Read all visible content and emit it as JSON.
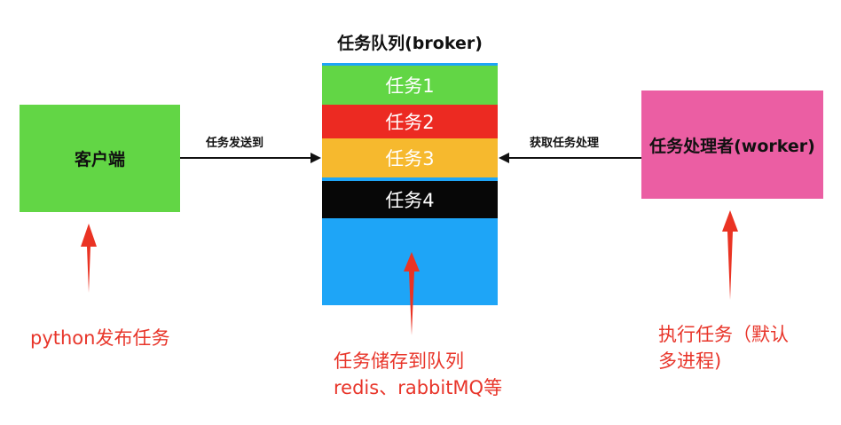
{
  "client": {
    "label": "客户端"
  },
  "queue": {
    "title": "任务队列(broker)",
    "tasks": [
      "任务1",
      "任务2",
      "任务3",
      "任务4"
    ]
  },
  "worker": {
    "label": "任务处理者(worker)"
  },
  "arrows": {
    "send_label": "任务发送到",
    "fetch_label": "获取任务处理"
  },
  "notes": {
    "client": "python发布任务",
    "queue_line1": "任务储存到队列",
    "queue_line2": "redis、rabbitMQ等",
    "worker_line1": "执行任务（默认",
    "worker_line2": "多进程)"
  },
  "colors": {
    "client_bg": "#62d645",
    "worker_bg": "#eb5ea3",
    "queue_bg": "#1ea5f7",
    "task1": "#62d645",
    "task2": "#ec2a22",
    "task3": "#f6b92e",
    "task4": "#070707",
    "note_red": "#e8352a"
  }
}
